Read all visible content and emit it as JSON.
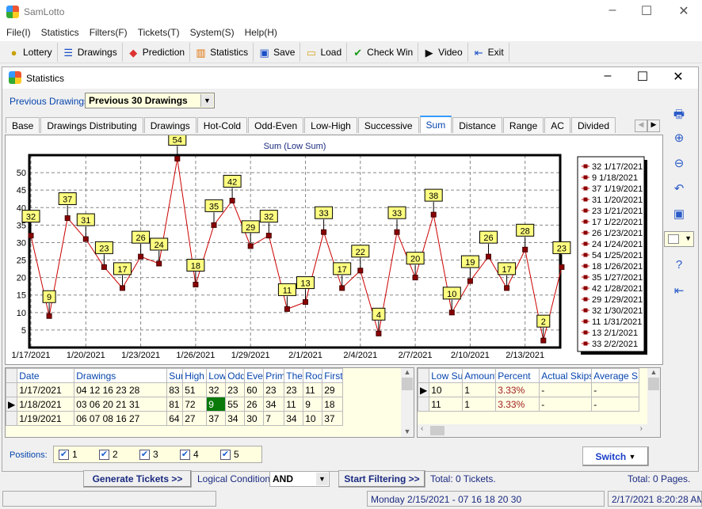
{
  "app": {
    "title": "SamLotto"
  },
  "menu": [
    "File(I)",
    "Statistics",
    "Filters(F)",
    "Tickets(T)",
    "System(S)",
    "Help(H)"
  ],
  "toolbar": [
    {
      "label": "Lottery",
      "icon": "lottery-ball-icon"
    },
    {
      "label": "Drawings",
      "icon": "drawings-list-icon"
    },
    {
      "label": "Prediction",
      "icon": "prediction-icon"
    },
    {
      "label": "Statistics",
      "icon": "bar-chart-icon"
    },
    {
      "label": "Save",
      "icon": "floppy-disk-icon"
    },
    {
      "label": "Load",
      "icon": "folder-open-icon"
    },
    {
      "label": "Check Win",
      "icon": "checkmark-icon"
    },
    {
      "label": "Video",
      "icon": "play-icon"
    },
    {
      "label": "Exit",
      "icon": "exit-door-icon"
    }
  ],
  "window": {
    "title": "Statistics"
  },
  "previous": {
    "label": "Previous Drawings:",
    "value": "Previous 30 Drawings"
  },
  "tabs": [
    "Base",
    "Drawings Distributing",
    "Drawings",
    "Hot-Cold",
    "Odd-Even",
    "Low-High",
    "Successive",
    "Sum",
    "Distance",
    "Range",
    "AC",
    "Divided"
  ],
  "active_tab": "Sum",
  "chart_data": {
    "type": "line",
    "title": "Sum (Low Sum)",
    "x": [
      "1/17/2021",
      "1/18/2021",
      "1/19/2021",
      "1/20/2021",
      "1/21/2021",
      "1/22/2021",
      "1/23/2021",
      "1/24/2021",
      "1/25/2021",
      "1/26/2021",
      "1/27/2021",
      "1/28/2021",
      "1/29/2021",
      "1/30/2021",
      "1/31/2021",
      "2/1/2021",
      "2/2/2021",
      "2/3/2021",
      "2/4/2021",
      "2/5/2021",
      "2/6/2021",
      "2/7/2021",
      "2/8/2021",
      "2/9/2021",
      "2/10/2021",
      "2/11/2021",
      "2/12/2021",
      "2/13/2021",
      "2/14/2021",
      "2/15/2021"
    ],
    "values": [
      32,
      9,
      37,
      31,
      23,
      17,
      26,
      24,
      54,
      18,
      35,
      42,
      29,
      32,
      11,
      13,
      33,
      17,
      22,
      4,
      33,
      20,
      38,
      10,
      19,
      26,
      17,
      28,
      2,
      23
    ],
    "xticks": [
      "1/17/2021",
      "1/20/2021",
      "1/23/2021",
      "1/26/2021",
      "1/29/2021",
      "2/1/2021",
      "2/4/2021",
      "2/7/2021",
      "2/10/2021",
      "2/13/2021"
    ],
    "yticks": [
      5,
      10,
      15,
      20,
      25,
      30,
      35,
      40,
      45,
      50
    ],
    "ylim": [
      0,
      55
    ],
    "grid": true,
    "legend_placement": "right",
    "legend": [
      "32 1/17/2021",
      "9 1/18/2021",
      "37 1/19/2021",
      "31 1/20/2021",
      "23 1/21/2021",
      "17 1/22/2021",
      "26 1/23/2021",
      "24 1/24/2021",
      "54 1/25/2021",
      "18 1/26/2021",
      "35 1/27/2021",
      "42 1/28/2021",
      "29 1/29/2021",
      "32 1/30/2021",
      "11 1/31/2021",
      "13 2/1/2021",
      "33 2/2/2021"
    ],
    "line_color": "#cc0000",
    "label_bg": "#ffff80"
  },
  "table1": {
    "headers": [
      "Date",
      "Drawings",
      "Sum",
      "High",
      "Low S",
      "Odd S",
      "Even",
      "Prime",
      "The U",
      "Root",
      "First"
    ],
    "rows": [
      [
        "1/17/2021",
        "04 12 16 23 28",
        "83",
        "51",
        "32",
        "23",
        "60",
        "23",
        "23",
        "11",
        "29"
      ],
      [
        "1/18/2021",
        "03 06 20 21 31",
        "81",
        "72",
        "9",
        "55",
        "26",
        "34",
        "11",
        "9",
        "18"
      ],
      [
        "1/19/2021",
        "06 07 08 16 27",
        "64",
        "27",
        "37",
        "34",
        "30",
        "7",
        "34",
        "10",
        "37"
      ]
    ]
  },
  "table2": {
    "headers": [
      "Low Sum",
      "Amount",
      "Percent",
      "Actual Skips",
      "Average S"
    ],
    "rows": [
      [
        "10",
        "1",
        "3.33%",
        "-",
        "-"
      ],
      [
        "11",
        "1",
        "3.33%",
        "-",
        "-"
      ]
    ]
  },
  "positions": {
    "label": "Positions:",
    "items": [
      "1",
      "2",
      "3",
      "4",
      "5"
    ]
  },
  "switch_label": "Switch",
  "bottom": {
    "generate": "Generate Tickets >>",
    "logical_label": "Logical Condition:",
    "logical_value": "AND",
    "start": "Start Filtering >>",
    "total_tickets": "Total: 0 Tickets.",
    "total_pages": "Total: 0 Pages."
  },
  "status": {
    "draw": "Monday 2/15/2021 - 07 16 18 20 30",
    "datetime": "2/17/2021 8:20:28 AM"
  }
}
